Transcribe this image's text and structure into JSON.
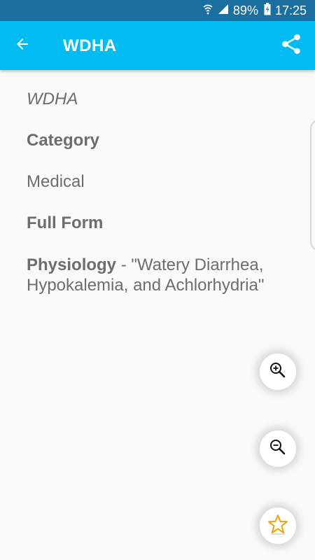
{
  "status_bar": {
    "battery_percent": "89%",
    "time": "17:25",
    "icons": [
      "wifi-icon",
      "signal-icon",
      "battery-icon"
    ]
  },
  "app_bar": {
    "title": "WDHA",
    "back_icon": "arrow-back-icon",
    "share_icon": "share-icon",
    "color": "#00bcf2"
  },
  "entry": {
    "term": "WDHA",
    "category_label": "Category",
    "category_value": "Medical",
    "full_form_label": "Full Form",
    "definition": {
      "category": "Physiology",
      "separator": " - ",
      "text": "\"Watery Diarrhea, Hypokalemia, and Achlorhydria\""
    }
  },
  "actions": {
    "zoom_in_icon": "zoom-in-icon",
    "zoom_out_icon": "zoom-out-icon",
    "favorite_icon": "star-icon"
  }
}
